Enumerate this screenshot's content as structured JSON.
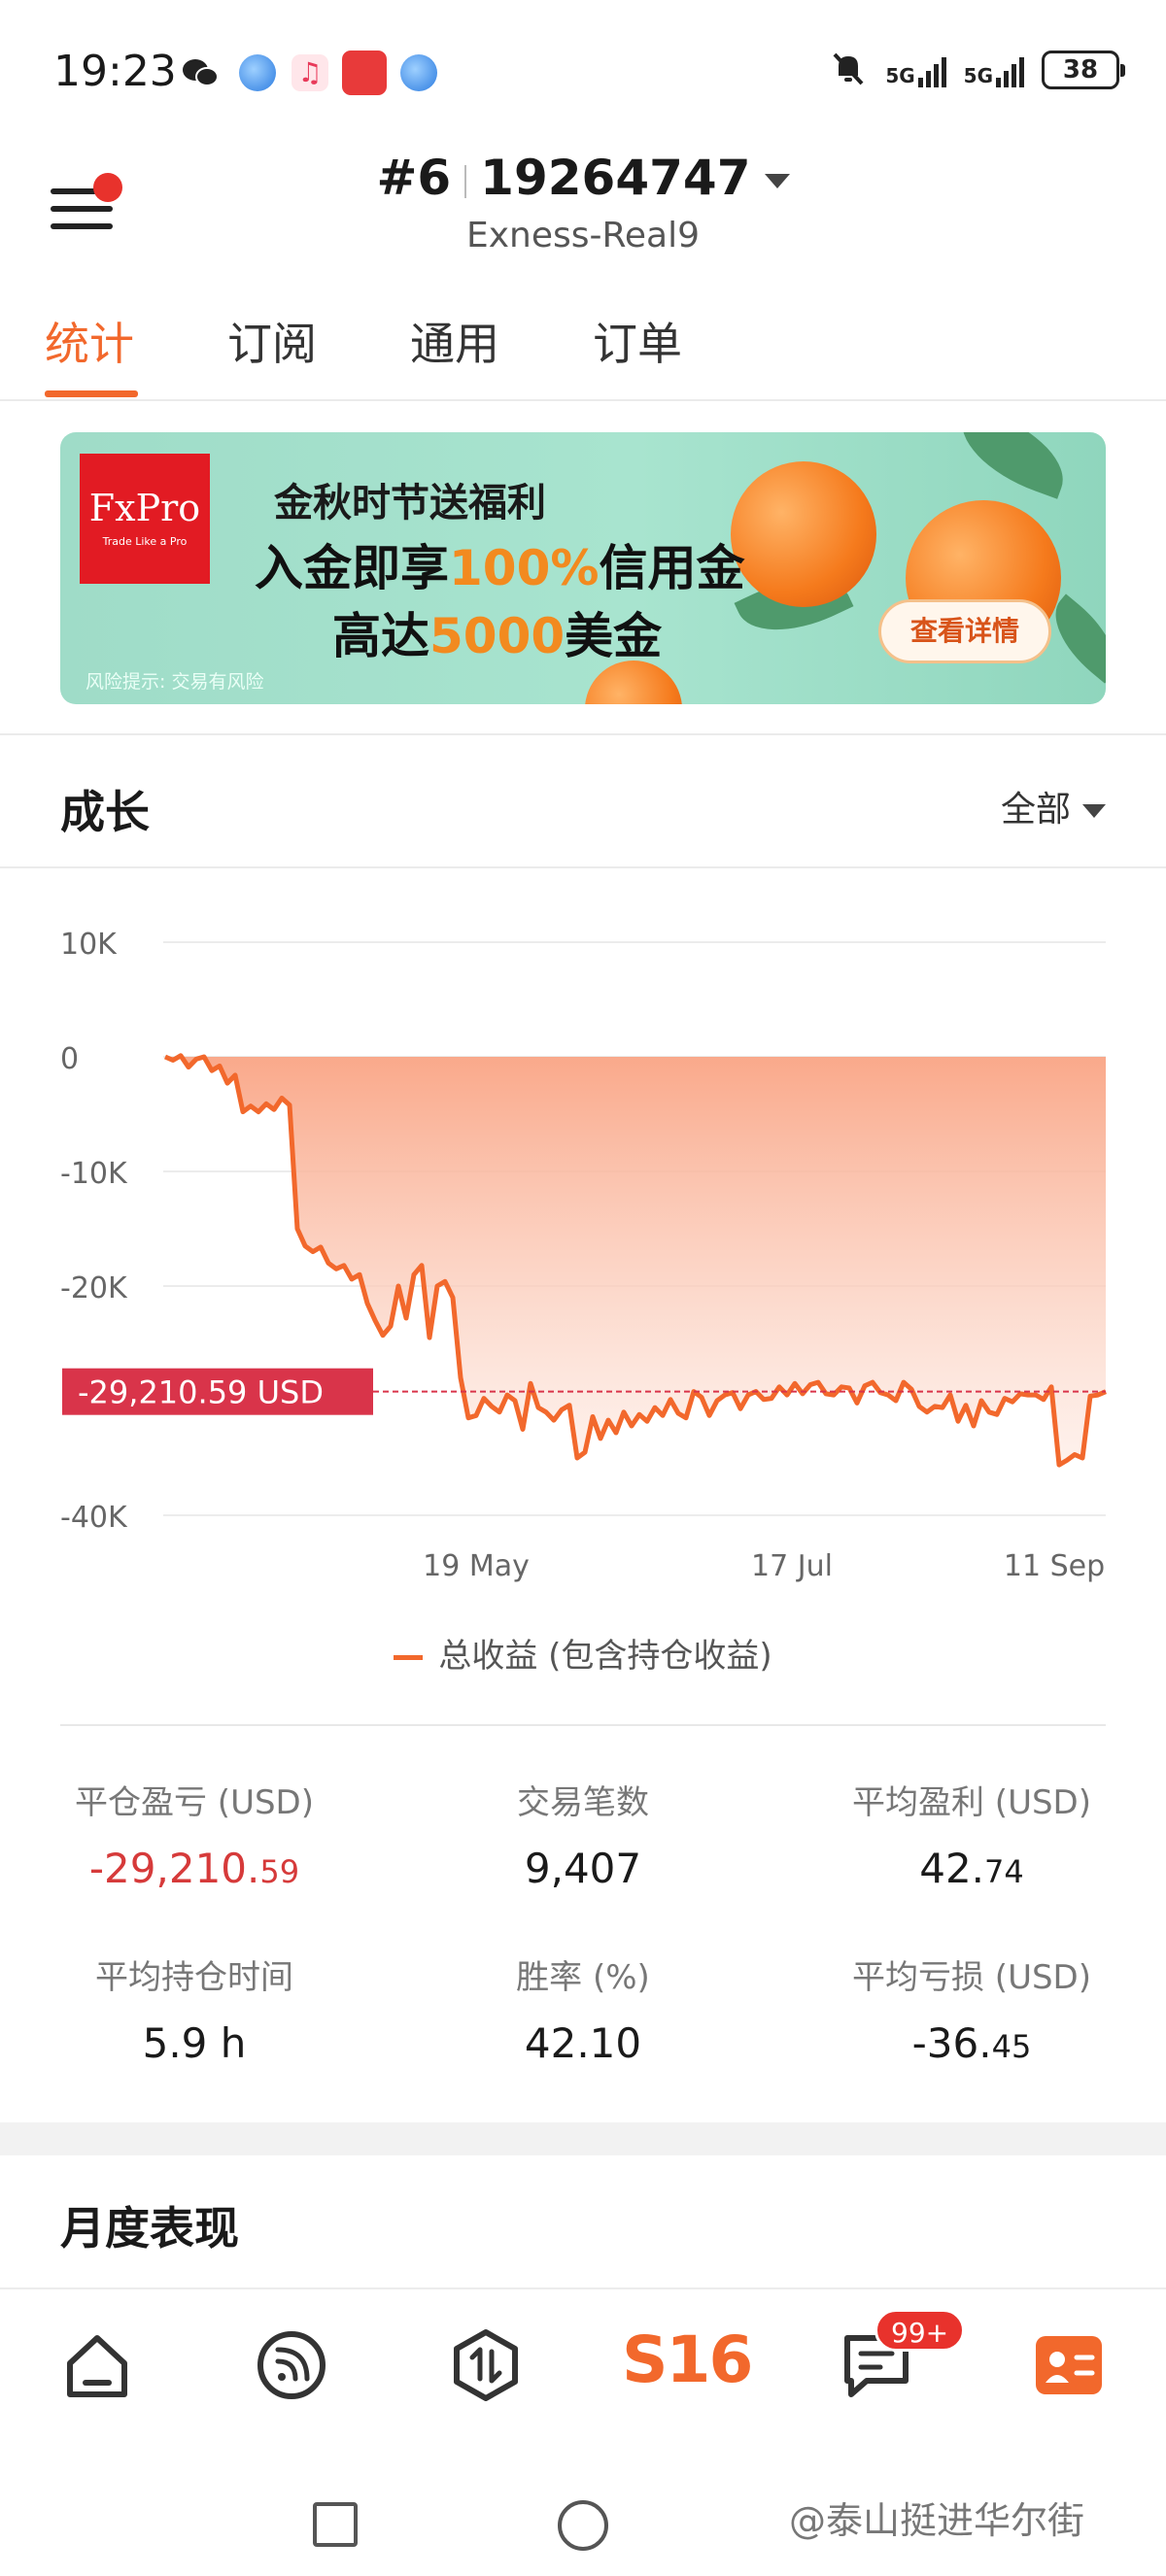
{
  "status_bar": {
    "time": "19:23",
    "network_1": "5G",
    "network_2": "5G",
    "battery": "38",
    "icons": [
      "wechat-icon",
      "browser-icon",
      "music-icon",
      "app-icon",
      "browser-icon",
      "mute-bell-icon"
    ]
  },
  "header": {
    "rank": "#6",
    "account_number": "19264747",
    "server": "Exness-Real9"
  },
  "tabs": [
    "统计",
    "订阅",
    "通用",
    "订单"
  ],
  "banner": {
    "brand": "FxPro",
    "brand_tagline": "Trade Like a Pro",
    "line1": "金秋时节送福利",
    "line2_a": "入金即享",
    "line2_b": "100%",
    "line2_c": "信用金",
    "line3_a": "高达",
    "line3_b": "5000",
    "line3_c": "美金",
    "risk": "风险提示: 交易有风险",
    "button": "查看详情"
  },
  "growth": {
    "title": "成长",
    "filter": "全部",
    "current_label": "-29,210.59 USD",
    "legend": "总收益 (包含持仓收益)"
  },
  "chart_data": {
    "type": "area",
    "y_ticks": [
      "10K",
      "0",
      "-10K",
      "-20K",
      "-40K"
    ],
    "ylim": [
      -40000,
      10000
    ],
    "x_ticks": [
      "19 May",
      "17 Jul",
      "11 Sep"
    ],
    "current_value": -29210.59,
    "series": [
      {
        "name": "总收益 (包含持仓收益)",
        "values": [
          0,
          -300,
          100,
          -900,
          -200,
          0,
          -1200,
          -800,
          -2300,
          -1600,
          -4800,
          -4300,
          -4800,
          -4100,
          -4600,
          -3600,
          -4200,
          -15000,
          -16500,
          -17000,
          -16600,
          -18000,
          -18500,
          -18200,
          -19400,
          -19000,
          -21500,
          -23000,
          -24300,
          -23500,
          -20000,
          -22800,
          -19000,
          -18200,
          -24500,
          -20000,
          -19600,
          -21000,
          -28000,
          -31500,
          -31300,
          -29800,
          -30500,
          -31000,
          -29500,
          -30000,
          -32500,
          -28500,
          -30600,
          -31000,
          -31700,
          -30800,
          -30400,
          -35000,
          -34500,
          -31400,
          -33300,
          -31700,
          -32800,
          -31000,
          -32200,
          -31200,
          -31800,
          -30600,
          -31300,
          -29900,
          -31100,
          -31500,
          -29200,
          -29700,
          -31300,
          -30000,
          -29500,
          -29300,
          -30700,
          -29500,
          -29200,
          -29900,
          -29800,
          -28800,
          -29500,
          -28500,
          -29400,
          -28600,
          -28400,
          -29400,
          -29500,
          -28800,
          -28900,
          -30200,
          -28700,
          -28400,
          -29300,
          -29500,
          -30000,
          -28400,
          -29000,
          -30500,
          -31000,
          -30500,
          -30600,
          -29500,
          -31800,
          -30400,
          -32200,
          -30000,
          -31000,
          -31200,
          -29800,
          -30100,
          -29400,
          -29500,
          -29500,
          -29900,
          -28800,
          -35600,
          -35200,
          -34700,
          -35000,
          -29600,
          -29500,
          -29210.59
        ]
      }
    ],
    "grid": true
  },
  "stats": [
    {
      "label": "平仓盈亏 (USD)",
      "int": "-29,210.",
      "dec": "59",
      "negative": true
    },
    {
      "label": "交易笔数",
      "int": "9,407",
      "dec": "",
      "negative": false
    },
    {
      "label": "平均盈利 (USD)",
      "int": "42.",
      "dec": "74",
      "negative": false
    },
    {
      "label": "平均持仓时间",
      "int": "5.9 h",
      "dec": "",
      "negative": false
    },
    {
      "label": "胜率 (%)",
      "int": "42.10",
      "dec": "",
      "negative": false
    },
    {
      "label": "平均亏损 (USD)",
      "int": "-36.",
      "dec": "45",
      "negative": false
    }
  ],
  "monthly": {
    "title": "月度表现"
  },
  "bottom_nav": {
    "s16": "S16",
    "badge": "99+"
  },
  "watermark": "@泰山挺进华尔街",
  "colors": {
    "accent": "#f2682c",
    "negative": "#d63a3a",
    "label_bg": "#d9344a"
  }
}
